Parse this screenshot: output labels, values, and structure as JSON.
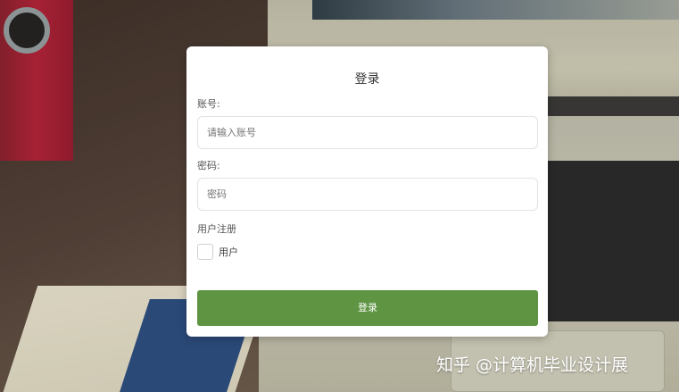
{
  "login": {
    "title": "登录",
    "account": {
      "label": "账号:",
      "placeholder": "请输入账号",
      "value": ""
    },
    "password": {
      "label": "密码:",
      "placeholder": "密码",
      "value": ""
    },
    "register_section_label": "用户注册",
    "role_checkbox": {
      "label": "用户",
      "checked": false
    },
    "submit_label": "登录",
    "button_color": "#5e9442"
  },
  "watermark": {
    "text": "知乎 @计算机毕业设计展"
  }
}
